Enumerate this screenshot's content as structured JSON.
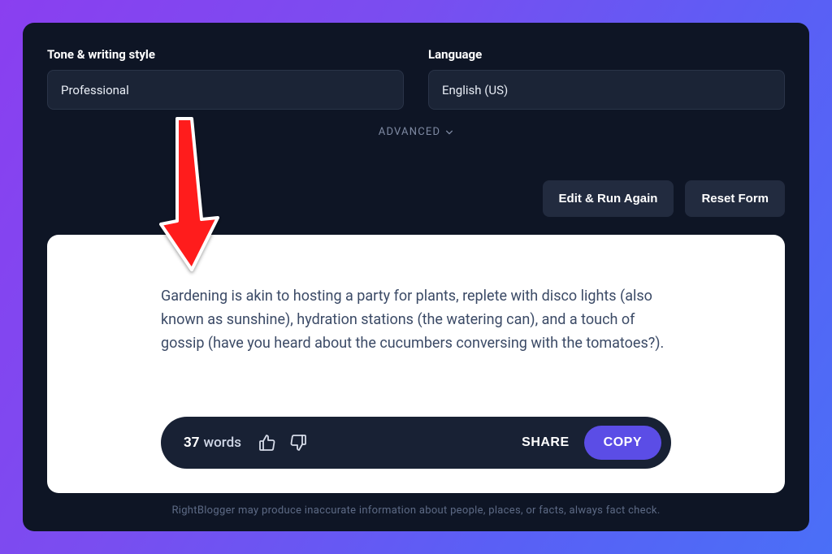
{
  "fields": {
    "tone": {
      "label": "Tone & writing style",
      "value": "Professional"
    },
    "language": {
      "label": "Language",
      "value": "English (US)"
    }
  },
  "advanced_label": "ADVANCED",
  "actions": {
    "edit_run": "Edit & Run Again",
    "reset": "Reset Form"
  },
  "result": {
    "text": "Gardening is akin to hosting a party for plants, replete with disco lights (also known as sunshine), hydration stations (the watering can), and a touch of gossip (have you heard about the cucumbers conversing with the tomatoes?).",
    "word_count": "37",
    "word_label": "words",
    "share_label": "SHARE",
    "copy_label": "COPY"
  },
  "disclaimer": "RightBlogger may produce inaccurate information about people, places, or facts, always fact check."
}
